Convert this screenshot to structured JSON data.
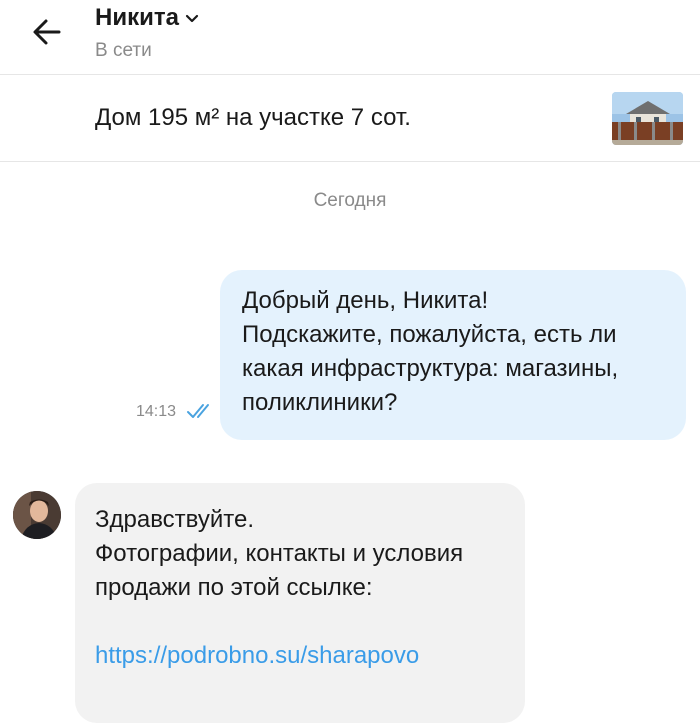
{
  "header": {
    "contact_name": "Никита",
    "status": "В сети"
  },
  "ad": {
    "title": "Дом 195 м² на участке 7 сот."
  },
  "chat": {
    "date_separator": "Сегодня",
    "outgoing": {
      "text": "Добрый день, Никита!\nПодскажите, пожалуйста, есть ли какая инфраструктура: магазины, поликлиники?",
      "time": "14:13",
      "status_icon": "double-check-icon"
    },
    "incoming": {
      "text": "Здравствуйте.\nФотографии, контакты и условия продажи по этой ссылке:",
      "link": "https://podrobno.su/sharapovo"
    }
  },
  "colors": {
    "outgoing_bubble": "#e4f2fd",
    "incoming_bubble": "#f2f2f2",
    "link": "#3a9ce8",
    "secondary_text": "#8a8a8a",
    "read_check": "#4aa3e0"
  }
}
